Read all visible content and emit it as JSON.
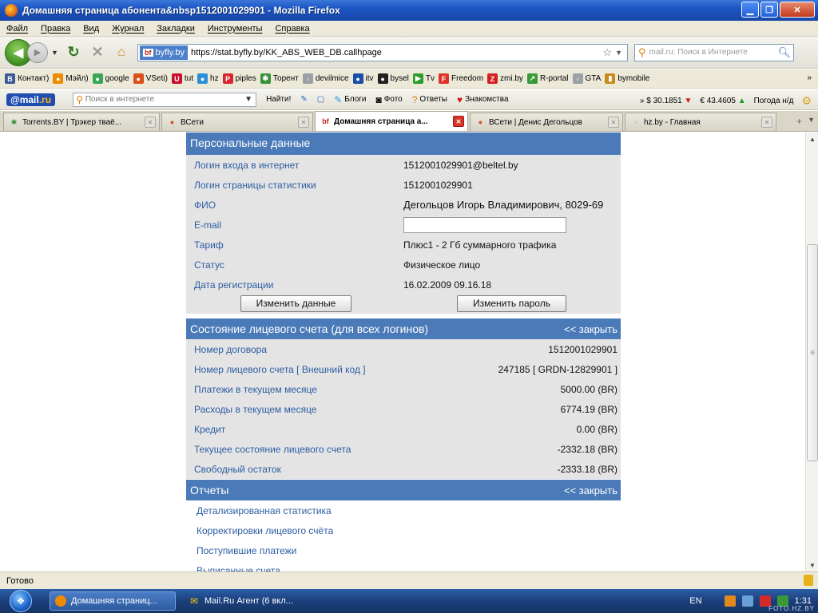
{
  "window": {
    "title": "Домашняя страница абонента&nbsp1512001029901 - Mozilla Firefox",
    "minimize_label": "▁",
    "maximize_label": "❐",
    "close_label": "✕"
  },
  "menu": [
    "Файл",
    "Правка",
    "Вид",
    "Журнал",
    "Закладки",
    "Инструменты",
    "Справка"
  ],
  "navbar": {
    "site_badge": "byfly.by",
    "site_badge_icon": "bf",
    "url": "https://stat.byfly.by/KK_ABS_WEB_DB.callhpage",
    "search_placeholder": "mail.ru: Поиск в Интернете"
  },
  "bookmarks": [
    {
      "label": "Контакт)",
      "icon": "В",
      "color": "#3b5998"
    },
    {
      "label": "Мэйл)",
      "icon": "●",
      "color": "#f08a00"
    },
    {
      "label": "google",
      "icon": "●",
      "color": "#3aa757"
    },
    {
      "label": "VSeti)",
      "icon": "●",
      "color": "#d9501c"
    },
    {
      "label": "tut",
      "icon": "U",
      "color": "#c8102e"
    },
    {
      "label": "hz",
      "icon": "●",
      "color": "#2b8fd8"
    },
    {
      "label": "piples",
      "icon": "P",
      "color": "#d8262f"
    },
    {
      "label": "Торент",
      "icon": "✱",
      "color": "#3a8f3a"
    },
    {
      "label": "devilmice",
      "icon": "▫",
      "color": "#9aa0a6"
    },
    {
      "label": "itv",
      "icon": "●",
      "color": "#1a4da8"
    },
    {
      "label": "bysel",
      "icon": "●",
      "color": "#222"
    },
    {
      "label": "Tv",
      "icon": "▶",
      "color": "#2a9d2a"
    },
    {
      "label": "Freedom",
      "icon": "F",
      "color": "#e0322b"
    },
    {
      "label": "zmi.by",
      "icon": "Z",
      "color": "#d42020"
    },
    {
      "label": "R-portal",
      "icon": "↗",
      "color": "#3a9a3a"
    },
    {
      "label": "GTA",
      "icon": "▫",
      "color": "#9aa0a6"
    },
    {
      "label": "bymobile",
      "icon": "▮",
      "color": "#c88a1e"
    }
  ],
  "bookmarks_more": "»",
  "mailbar": {
    "logo_prefix": "@mail",
    "logo_suffix": ".ru",
    "search_placeholder": "Поиск в интернете",
    "find_label": "Найти!",
    "blogs": "Блоги",
    "photo": "Фото",
    "answers": "Ответы",
    "dating": "Знакомства",
    "usd": "» $ 30.1851",
    "eur": "€ 43.4605",
    "weather": "Погода н/д"
  },
  "tabs": [
    {
      "label": "Torrents.BY | Трэкер тваё...",
      "icon": "✱",
      "icon_color": "#3a8f3a",
      "active": false
    },
    {
      "label": "ВСети",
      "icon": "●",
      "icon_color": "#d9501c",
      "active": false
    },
    {
      "label": "Домашняя страница а...",
      "icon": "bf",
      "icon_color": "#c41f1f",
      "active": true
    },
    {
      "label": "ВСети | Денис Дегольцов",
      "icon": "●",
      "icon_color": "#d9501c",
      "active": false
    },
    {
      "label": "hz.by - Главная",
      "icon": "▫",
      "icon_color": "#9aa0a6",
      "active": false
    }
  ],
  "personal": {
    "header": "Персональные данные",
    "rows": [
      {
        "label": "Логин входа в интернет",
        "value": "1512001029901@beltel.by"
      },
      {
        "label": "Логин страницы статистики",
        "value": "1512001029901"
      },
      {
        "label": "ФИО",
        "value": "Дегольцов Игорь Владимирович, 8029-69"
      },
      {
        "label": "E-mail",
        "value": ""
      },
      {
        "label": "Тариф",
        "value": "Плюс1 - 2 Гб суммарного трафика"
      },
      {
        "label": "Статус",
        "value": "Физическое лицо"
      },
      {
        "label": "Дата регистрации",
        "value": "16.02.2009 09.16.18"
      }
    ],
    "change_data_button": "Изменить данные",
    "change_password_button": "Изменить пароль"
  },
  "account": {
    "header": "Состояние лицевого счета (для всех логинов)",
    "close_link": "<< закрыть",
    "rows": [
      {
        "label": "Номер договора",
        "value": "1512001029901"
      },
      {
        "label": "Номер лицевого счета   [ Внешний код ]",
        "value": "247185  [ GRDN-12829901 ]"
      },
      {
        "label": "Платежи в текущем месяце",
        "value": "5000.00 (BR)"
      },
      {
        "label": "Расходы в текущем месяце",
        "value": "6774.19 (BR)"
      },
      {
        "label": "Кредит",
        "value": "0.00 (BR)"
      },
      {
        "label": "Текущее состояние лицевого счета",
        "value": "-2332.18 (BR)"
      },
      {
        "label": "Свободный остаток",
        "value": "-2333.18 (BR)"
      }
    ]
  },
  "reports": {
    "header": "Отчеты",
    "close_link": "<< закрыть",
    "links": [
      "Детализированная статистика",
      "Корректировки лицевого счёта",
      "Поступившие платежи",
      "Выписанные счета"
    ]
  },
  "status": {
    "text": "Готово"
  },
  "taskbar": {
    "items": [
      {
        "label": "Домашняя страниц...",
        "icon": "●",
        "icon_color": "#f08a00",
        "active": true
      },
      {
        "label": "Mail.Ru Агент (6 вкл...",
        "icon": "✉",
        "icon_color": "#f5c400",
        "active": false
      }
    ],
    "lang": "EN",
    "time": "1:31"
  },
  "watermark": "FOTO.HZ.BY",
  "colors": {
    "panel_header": "#4a7ab8",
    "panel_body": "#e4e4e4",
    "label_link": "#2b5da2"
  }
}
